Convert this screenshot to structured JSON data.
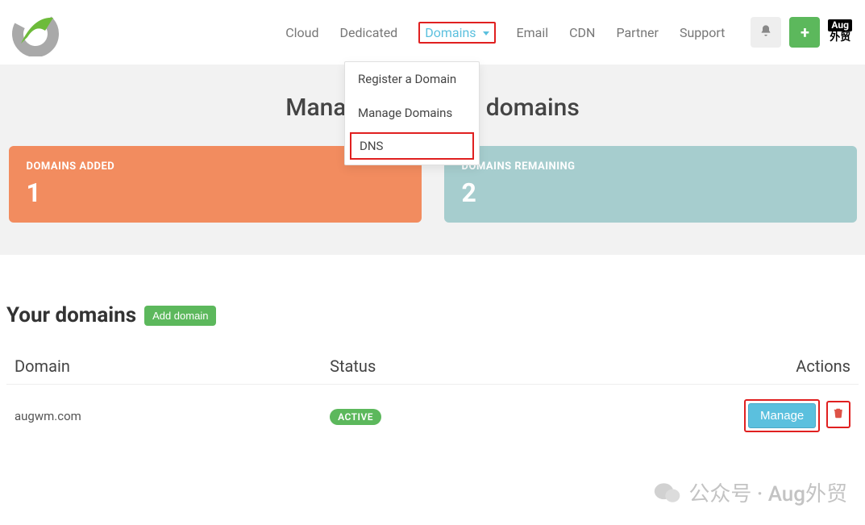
{
  "nav": {
    "cloud": "Cloud",
    "dedicated": "Dedicated",
    "domains": "Domains",
    "email": "Email",
    "cdn": "CDN",
    "partner": "Partner",
    "support": "Support"
  },
  "badge": {
    "top": "Aug",
    "bot": "外贸"
  },
  "dropdown": {
    "register": "Register a Domain",
    "manage": "Manage Domains",
    "dns": "DNS"
  },
  "hero": {
    "title": "Manage your DNS domains",
    "added_label": "DOMAINS ADDED",
    "added_value": "1",
    "remaining_label": "DOMAINS REMAINING",
    "remaining_value": "2"
  },
  "section": {
    "title": "Your domains",
    "add_button": "Add domain"
  },
  "table": {
    "cols": {
      "domain": "Domain",
      "status": "Status",
      "actions": "Actions"
    },
    "row": {
      "domain": "augwm.com",
      "status": "ACTIVE",
      "manage": "Manage"
    }
  },
  "watermark": {
    "text": "公众号 · Aug外贸"
  }
}
